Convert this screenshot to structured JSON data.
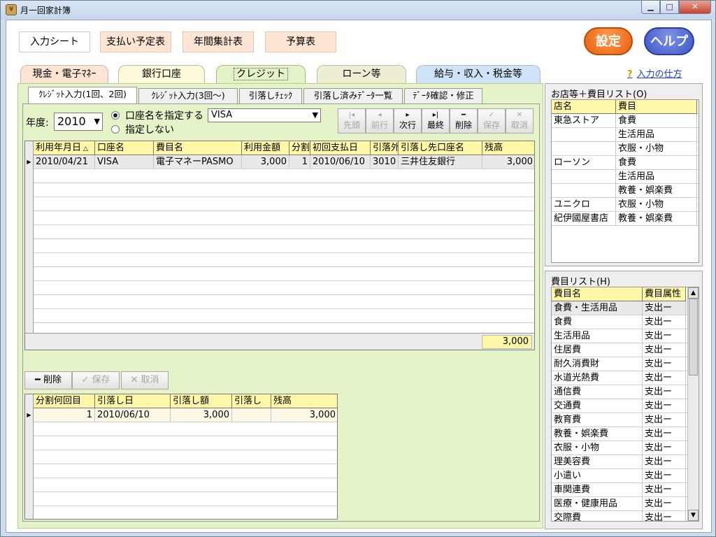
{
  "window": {
    "title": "月一回家計簿",
    "icon": "app-icon",
    "min": "▁",
    "max": "□",
    "close": "✕"
  },
  "top_buttons": [
    {
      "label": "入力シート",
      "active": true
    },
    {
      "label": "支払い予定表",
      "active": false
    },
    {
      "label": "年間集計表",
      "active": false
    },
    {
      "label": "予算表",
      "active": false
    }
  ],
  "settings_label": "設定",
  "help_label": "ヘルプ",
  "main_tabs": [
    {
      "label": "現金・電子ﾏﾈｰ"
    },
    {
      "label": "銀行口座"
    },
    {
      "label": "クレジット"
    },
    {
      "label": "ローン等"
    },
    {
      "label": "給与・収入・税金等"
    }
  ],
  "help_link": {
    "icon": "?",
    "label": "入力の仕方"
  },
  "sub_tabs": [
    {
      "label": "ｸﾚｼﾞｯﾄ入力(1回、2回)"
    },
    {
      "label": "ｸﾚｼﾞｯﾄ入力(3回～)"
    },
    {
      "label": "引落しﾁｪｯｸ"
    },
    {
      "label": "引落し済みﾃﾞｰﾀ一覧"
    },
    {
      "label": "ﾃﾞｰﾀ確認・修正"
    }
  ],
  "filter": {
    "year_label": "年度:",
    "year_value": "2010",
    "radio_specify": "口座名を指定する",
    "radio_none": "指定しない",
    "account_value": "VISA"
  },
  "nav_buttons": {
    "first": {
      "glyph": "|◂",
      "label": "先頭"
    },
    "prev": {
      "glyph": "◂",
      "label": "前行"
    },
    "next": {
      "glyph": "▸",
      "label": "次行"
    },
    "last": {
      "glyph": "▸|",
      "label": "最終"
    },
    "delete": {
      "glyph": "━",
      "label": "削除"
    },
    "save": {
      "glyph": "✓",
      "label": "保存"
    },
    "cancel": {
      "glyph": "✕",
      "label": "取消"
    }
  },
  "main_grid": {
    "headers": [
      "利用年月日",
      "口座名",
      "費目名",
      "利用金額",
      "分割",
      "初回支払日",
      "引落外",
      "引落し先口座名",
      "残高"
    ],
    "sort_glyph": "△",
    "rows": [
      {
        "date": "2010/04/21",
        "account": "VISA",
        "item": "電子マネーPASMO",
        "amount": "3,000",
        "split": "1",
        "first_pay": "2010/06/10",
        "code": "3010",
        "bank": "三井住友銀行",
        "balance": "3,000"
      }
    ],
    "total": "3,000"
  },
  "sub_toolbar": {
    "delete": "━ 削除",
    "save": "✓ 保存",
    "cancel": "✕ 取消"
  },
  "sub_grid": {
    "headers": [
      "分割何回目",
      "引落し日",
      "引落し額",
      "引落し",
      "残高"
    ],
    "rows": [
      {
        "n": "1",
        "date": "2010/06/10",
        "amount": "3,000",
        "flag": "",
        "balance": "3,000"
      }
    ]
  },
  "store_list": {
    "caption": "お店等＋費目リスト(O)",
    "headers": [
      "店名",
      "費目"
    ],
    "rows": [
      {
        "store": "東急ストア",
        "item": "食費"
      },
      {
        "store": "",
        "item": "生活用品"
      },
      {
        "store": "",
        "item": "衣服・小物"
      },
      {
        "store": "ローソン",
        "item": "食費"
      },
      {
        "store": "",
        "item": "生活用品"
      },
      {
        "store": "",
        "item": "教養・娯楽費"
      },
      {
        "store": "ユニクロ",
        "item": "衣服・小物"
      },
      {
        "store": "紀伊國屋書店",
        "item": "教養・娯楽費"
      }
    ]
  },
  "item_list": {
    "caption": "費目リスト(H)",
    "headers": [
      "費目名",
      "費目属性"
    ],
    "rows": [
      {
        "name": "食費・生活用品",
        "attr": "支出ー"
      },
      {
        "name": "食費",
        "attr": "支出ー"
      },
      {
        "name": "生活用品",
        "attr": "支出ー"
      },
      {
        "name": "住居費",
        "attr": "支出ー"
      },
      {
        "name": "耐久消費財",
        "attr": "支出ー"
      },
      {
        "name": "水道光熱費",
        "attr": "支出ー"
      },
      {
        "name": "通信費",
        "attr": "支出ー"
      },
      {
        "name": "交通費",
        "attr": "支出ー"
      },
      {
        "name": "教育費",
        "attr": "支出ー"
      },
      {
        "name": "教養・娯楽費",
        "attr": "支出ー"
      },
      {
        "name": "衣服・小物",
        "attr": "支出ー"
      },
      {
        "name": "理美容費",
        "attr": "支出ー"
      },
      {
        "name": "小遣い",
        "attr": "支出ー"
      },
      {
        "name": "車関連費",
        "attr": "支出ー"
      },
      {
        "name": "医療・健康用品",
        "attr": "支出ー"
      },
      {
        "name": "交際費",
        "attr": "支出ー"
      }
    ]
  }
}
